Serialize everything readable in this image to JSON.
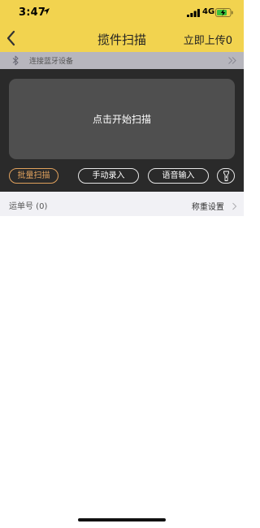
{
  "status": {
    "time": "3:47",
    "network": "4G"
  },
  "nav": {
    "title": "揽件扫描",
    "upload_label": "立即上传0"
  },
  "bluetooth": {
    "label": "连接蓝牙设备"
  },
  "scan": {
    "prompt": "点击开始扫描",
    "modes": {
      "batch": "批量扫描",
      "manual": "手动录入",
      "voice": "语音输入"
    }
  },
  "list": {
    "waybill_label": "运单号 (0)",
    "weight_setting": "称重设置"
  },
  "colors": {
    "header": "#f2d34f",
    "accent": "#e0a15d",
    "scan_bg": "#2a2a2a",
    "scan_box": "#4f4f4f",
    "battery_charge": "#3bbf3b"
  },
  "icons": [
    "location-arrow-icon",
    "signal-icon",
    "battery-charging-icon",
    "back-chevron-icon",
    "bluetooth-icon",
    "double-chevron-right-icon",
    "flashlight-icon",
    "chevron-right-icon"
  ]
}
